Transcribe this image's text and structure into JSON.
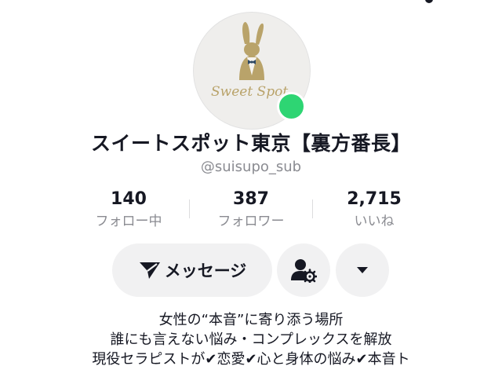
{
  "profile": {
    "display_name": "スイートスポット東京【裏方番長】",
    "username": "@suisupo_sub",
    "avatar_text": "Sweet Spot",
    "online": true
  },
  "stats": [
    {
      "value": "140",
      "label": "フォロー中"
    },
    {
      "value": "387",
      "label": "フォロワー"
    },
    {
      "value": "2,715",
      "label": "いいね"
    }
  ],
  "actions": {
    "message_label": "メッセージ",
    "send_icon": "paper-plane-icon",
    "follow_settings_icon": "user-gear-icon",
    "more_icon": "caret-down-icon"
  },
  "bio": {
    "lines": [
      "女性の“本音”に寄り添う場所",
      "誰にも言えない悩み・コンプレックスを解放",
      "現役セラピストが✔恋愛✔心と身体の悩み✔本音ト"
    ]
  },
  "colors": {
    "online": "#2ed573",
    "button_bg": "#f1f1f2",
    "secondary_text": "#8a8b91",
    "logo_gold": "#b9a36a"
  }
}
